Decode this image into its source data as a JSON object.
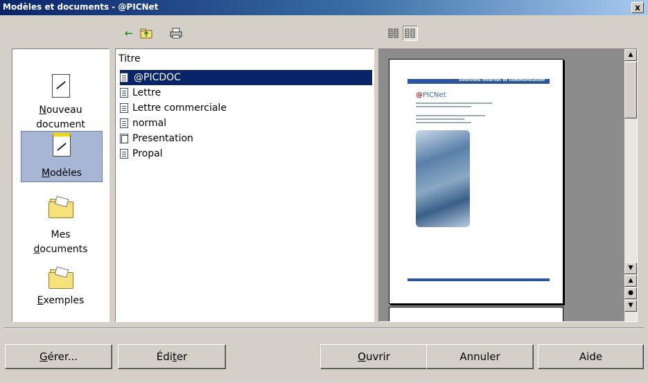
{
  "window": {
    "title": "Modèles et documents - @PICNet",
    "close_label": "x"
  },
  "toolbar": {
    "back_icon": "arrow-left-icon",
    "up_icon": "folder-up-icon",
    "print_icon": "printer-icon",
    "preview_doc_icon": "document-preview-icon",
    "preview_props_icon": "document-properties-icon"
  },
  "categories": [
    {
      "label_u": "N",
      "label_rest": "ouveau",
      "label_line2": "document"
    },
    {
      "label_u": "M",
      "label_rest": "odèles"
    },
    {
      "label_line1": "Mes",
      "label_u": "d",
      "label_rest": "ocuments"
    },
    {
      "label_u": "E",
      "label_rest": "xemples"
    }
  ],
  "list": {
    "header": "Titre",
    "items": [
      {
        "label": "@PICDOC",
        "selected": true
      },
      {
        "label": "Lettre"
      },
      {
        "label": "Lettre commerciale"
      },
      {
        "label": "normal"
      },
      {
        "label": "Presentation"
      },
      {
        "label": "Propal"
      }
    ]
  },
  "preview": {
    "banner_text": "Solutions Internet et communication",
    "logo_text": "PICNet",
    "logo_at": "@"
  },
  "buttons": {
    "manage_u": "G",
    "manage_rest": "érer...",
    "edit_pre": "Édi",
    "edit_u": "t",
    "edit_rest": "er",
    "open_u": "O",
    "open_rest": "uvrir",
    "cancel": "Annuler",
    "help": "Aide"
  },
  "colors": {
    "selection": "#0a246a",
    "accent": "#2a55a0"
  }
}
